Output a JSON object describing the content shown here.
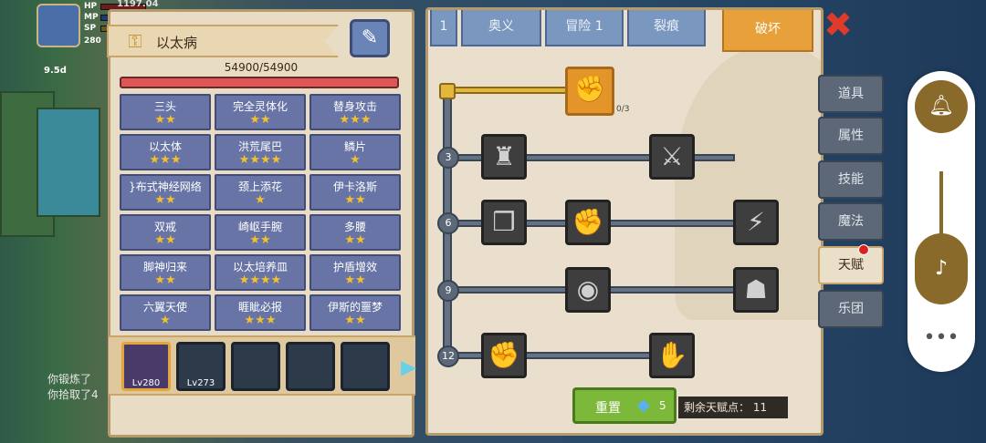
{
  "hud": {
    "hp_label": "HP",
    "mp_label": "MP",
    "sp_label": "SP",
    "level": "280",
    "hp_value": "1197.04",
    "timer": "9.5d"
  },
  "chat": {
    "line1": "你锻炼了",
    "line2": "你拾取了4"
  },
  "left_panel": {
    "title": "以太病",
    "hp_text": "54900/54900",
    "hp_fraction": 1.0,
    "traits": [
      {
        "name": "三头",
        "stars": "★★"
      },
      {
        "name": "完全灵体化",
        "stars": "★★"
      },
      {
        "name": "替身攻击",
        "stars": "★★★"
      },
      {
        "name": "以太体",
        "stars": "★★★"
      },
      {
        "name": "洪荒尾巴",
        "stars": "★★★★"
      },
      {
        "name": "鳞片",
        "stars": "★"
      },
      {
        "name": "}布式神经网络",
        "stars": "★★"
      },
      {
        "name": "颈上添花",
        "stars": "★"
      },
      {
        "name": "伊卡洛斯",
        "stars": "★★"
      },
      {
        "name": "双戒",
        "stars": "★★"
      },
      {
        "name": "崎岖手腕",
        "stars": "★★"
      },
      {
        "name": "多腰",
        "stars": "★★"
      },
      {
        "name": "脚神归来",
        "stars": "★★"
      },
      {
        "name": "以太培养皿",
        "stars": "★★★★"
      },
      {
        "name": "护盾增效",
        "stars": "★★"
      },
      {
        "name": "六翼天使",
        "stars": "★"
      },
      {
        "name": "睚眦必报",
        "stars": "★★★"
      },
      {
        "name": "伊斯的噩梦",
        "stars": "★★"
      }
    ],
    "slots": [
      {
        "level": "Lv280"
      },
      {
        "level": "Lv273"
      },
      {
        "level": ""
      },
      {
        "level": ""
      },
      {
        "level": ""
      }
    ]
  },
  "right_panel": {
    "tabs": [
      "1",
      "奥义",
      "冒险 1",
      "裂痕",
      "破坏"
    ],
    "active_tab": "破坏",
    "top_count": "0/3",
    "levels": [
      "3",
      "6",
      "9",
      "12"
    ],
    "reset_label": "重置",
    "reset_cost": "5",
    "remaining": "剩余天赋点： 11"
  },
  "side_tabs": [
    "道具",
    "属性",
    "技能",
    "魔法",
    "天赋",
    "乐团"
  ],
  "active_side_tab": "天赋",
  "icons": {
    "close": "close-icon",
    "key": "key-icon",
    "syringe": "syringe-icon",
    "gem": "diamond-icon",
    "bell": "bell-icon",
    "music": "music-icon",
    "more": "more-icon"
  },
  "colors": {
    "active_tab": "#e8a13a",
    "star": "#f2c12b",
    "reset": "#7cb83a",
    "hp_bar": "#e05555"
  }
}
